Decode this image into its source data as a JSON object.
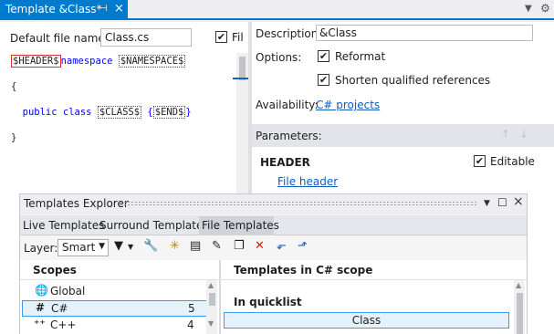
{
  "window": {
    "tab_title": "Template &Class*",
    "pin_icon": "pin-icon",
    "close_icon": "close-icon"
  },
  "editor": {
    "default_file_name_label": "Default file name:",
    "default_file_name_value": "Class.cs",
    "file_checkbox_label": "Fil",
    "file_checked": true,
    "code_lines": [
      {
        "parts": [
          "$HEADER$",
          "namespace ",
          "$NAMESPACE$"
        ]
      },
      {
        "text": "{"
      },
      {
        "parts": [
          "  public class ",
          "$CLASS$",
          " {",
          "$END$",
          "}"
        ]
      },
      {
        "text": "}"
      }
    ]
  },
  "properties": {
    "description_label": "Description:",
    "description_value": "&Class",
    "options_label": "Options:",
    "reformat_label": "Reformat",
    "reformat_checked": true,
    "shorten_label": "Shorten qualified references",
    "shorten_checked": true,
    "availability_label": "Availability:",
    "availability_link": "C# projects",
    "parameters_label": "Parameters:",
    "param_name": "HEADER",
    "editable_label": "Editable",
    "editable_checked": true,
    "param_macro_link": "File header"
  },
  "explorer": {
    "title": "Templates Explorer",
    "tabs": [
      {
        "label": "Live Templates",
        "active": false
      },
      {
        "label": "Surround Templates",
        "active": false
      },
      {
        "label": "File Templates",
        "active": true
      }
    ],
    "layer_label": "Layer:",
    "layer_value": "Smart",
    "scopes_header": "Scopes",
    "scopes": [
      {
        "label": "Global",
        "count": "",
        "icon": "globe-icon",
        "glyph": "🌐"
      },
      {
        "label": "C#",
        "count": "5",
        "icon": "hash-icon",
        "glyph": "#"
      },
      {
        "label": "C++",
        "count": "4",
        "icon": "cpp-icon",
        "glyph": "⁺⁺"
      }
    ],
    "templates_header": "Templates in C# scope",
    "group_label": "In quicklist",
    "templates": [
      "Class"
    ]
  },
  "colors": {
    "accent": "#007acc",
    "link": "#0f5dbd",
    "selection_border": "#3399ff",
    "delete_red": "#e51400"
  }
}
